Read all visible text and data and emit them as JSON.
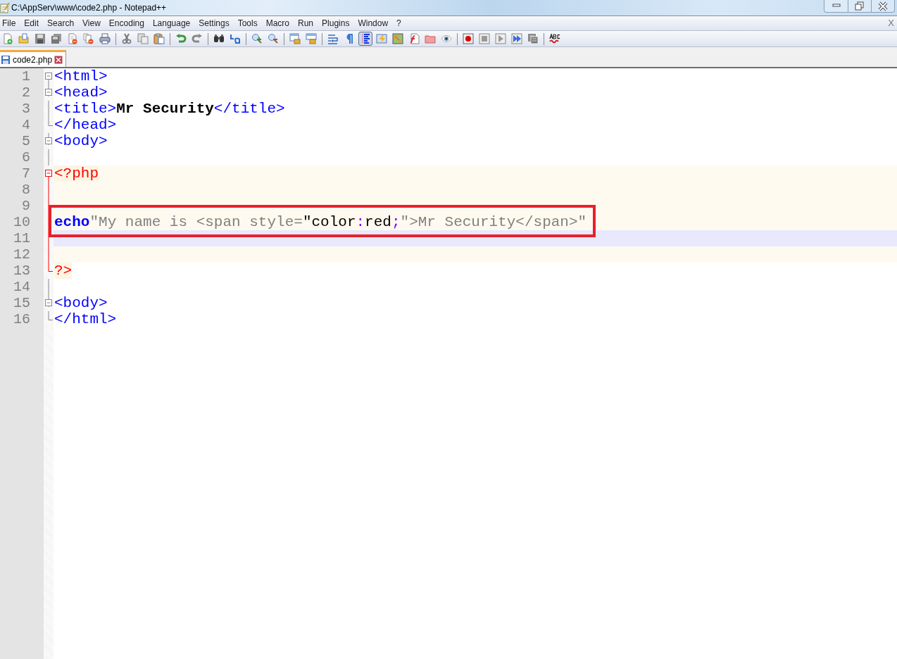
{
  "window": {
    "title": "C:\\AppServ\\www\\code2.php - Notepad++"
  },
  "menu": [
    {
      "label": "File"
    },
    {
      "label": "Edit"
    },
    {
      "label": "Search"
    },
    {
      "label": "View"
    },
    {
      "label": "Encoding"
    },
    {
      "label": "Language"
    },
    {
      "label": "Settings"
    },
    {
      "label": "Tools"
    },
    {
      "label": "Macro"
    },
    {
      "label": "Run"
    },
    {
      "label": "Plugins"
    },
    {
      "label": "Window"
    },
    {
      "label": "?"
    }
  ],
  "menu_close": "X",
  "toolbar": [
    {
      "kind": "new",
      "selected": false
    },
    {
      "kind": "open",
      "selected": false
    },
    {
      "kind": "save",
      "selected": false
    },
    {
      "kind": "save-all",
      "selected": false
    },
    {
      "kind": "close",
      "selected": false
    },
    {
      "kind": "close-all",
      "selected": false
    },
    {
      "kind": "print",
      "selected": false
    },
    {
      "kind": "separator"
    },
    {
      "kind": "cut",
      "selected": false
    },
    {
      "kind": "copy",
      "selected": false
    },
    {
      "kind": "paste",
      "selected": false
    },
    {
      "kind": "separator"
    },
    {
      "kind": "undo",
      "selected": false
    },
    {
      "kind": "redo",
      "selected": false
    },
    {
      "kind": "separator"
    },
    {
      "kind": "find",
      "selected": false
    },
    {
      "kind": "replace",
      "selected": false
    },
    {
      "kind": "separator"
    },
    {
      "kind": "zoom-in",
      "selected": false
    },
    {
      "kind": "zoom-out",
      "selected": false
    },
    {
      "kind": "separator"
    },
    {
      "kind": "sync-v",
      "selected": false
    },
    {
      "kind": "sync-h",
      "selected": false
    },
    {
      "kind": "separator"
    },
    {
      "kind": "wrap",
      "selected": false
    },
    {
      "kind": "pilcrow",
      "selected": false
    },
    {
      "kind": "indent-guide",
      "selected": true
    },
    {
      "kind": "lightning",
      "selected": false
    },
    {
      "kind": "map",
      "selected": false
    },
    {
      "kind": "function-list",
      "selected": false
    },
    {
      "kind": "folder",
      "selected": false
    },
    {
      "kind": "eye",
      "selected": false
    },
    {
      "kind": "separator"
    },
    {
      "kind": "record",
      "selected": false
    },
    {
      "kind": "stop",
      "selected": false
    },
    {
      "kind": "play",
      "selected": false
    },
    {
      "kind": "play-multi",
      "selected": false
    },
    {
      "kind": "save-macro",
      "selected": false
    },
    {
      "kind": "separator"
    },
    {
      "kind": "spellcheck",
      "selected": false
    }
  ],
  "tabs": [
    {
      "label": "code2.php",
      "selected": true
    }
  ],
  "lines": [
    {
      "number": "1",
      "fold_start": true,
      "fold_end": false,
      "php_fold": false,
      "php_block": false,
      "current": false,
      "highlighted": false,
      "tokens": [
        {
          "kind": "tag",
          "text": "<html>"
        }
      ]
    },
    {
      "number": "2",
      "fold_start": true,
      "fold_end": false,
      "php_fold": false,
      "php_block": false,
      "current": false,
      "highlighted": false,
      "tokens": [
        {
          "kind": "tag",
          "text": "<head>"
        }
      ]
    },
    {
      "number": "3",
      "fold_start": false,
      "fold_end": false,
      "php_fold": false,
      "php_block": false,
      "current": false,
      "highlighted": false,
      "tokens": [
        {
          "kind": "tag",
          "text": "<title>"
        },
        {
          "kind": "content",
          "text": "Mr Security"
        },
        {
          "kind": "tag",
          "text": "</title>"
        }
      ]
    },
    {
      "number": "4",
      "fold_start": false,
      "fold_end": true,
      "php_fold": false,
      "php_block": false,
      "current": false,
      "highlighted": false,
      "tokens": [
        {
          "kind": "tag",
          "text": "</head>"
        }
      ]
    },
    {
      "number": "5",
      "fold_start": true,
      "fold_end": false,
      "php_fold": false,
      "php_block": false,
      "current": false,
      "highlighted": false,
      "tokens": [
        {
          "kind": "tag",
          "text": "<body>"
        }
      ]
    },
    {
      "number": "6",
      "fold_start": false,
      "fold_end": false,
      "php_fold": false,
      "php_block": false,
      "current": false,
      "highlighted": false
    },
    {
      "number": "7",
      "fold_start": true,
      "fold_end": false,
      "php_fold": true,
      "php_block": true,
      "current": false,
      "highlighted": false,
      "tokens": [
        {
          "kind": "php-delim",
          "text": "<?php"
        }
      ]
    },
    {
      "number": "8",
      "fold_start": false,
      "fold_end": false,
      "php_fold": true,
      "php_block": true,
      "current": false,
      "highlighted": false
    },
    {
      "number": "9",
      "fold_start": false,
      "fold_end": false,
      "php_fold": true,
      "php_block": true,
      "current": false,
      "highlighted": false
    },
    {
      "number": "10",
      "fold_start": false,
      "fold_end": false,
      "php_fold": true,
      "php_block": true,
      "current": false,
      "highlighted": true,
      "tokens": [
        {
          "kind": "keyword",
          "text": "echo"
        },
        {
          "kind": "string",
          "text": "\"My name is <span style="
        },
        {
          "kind": "css",
          "text": "\"color"
        },
        {
          "kind": "css-op",
          "text": ":"
        },
        {
          "kind": "css",
          "text": "red"
        },
        {
          "kind": "css-op",
          "text": ";"
        },
        {
          "kind": "string",
          "text": "\">Mr Security</span>\""
        }
      ]
    },
    {
      "number": "11",
      "fold_start": false,
      "fold_end": false,
      "php_fold": true,
      "php_block": true,
      "current": true,
      "highlighted": false
    },
    {
      "number": "12",
      "fold_start": false,
      "fold_end": false,
      "php_fold": true,
      "php_block": true,
      "current": false,
      "highlighted": false
    },
    {
      "number": "13",
      "fold_start": false,
      "fold_end": true,
      "php_fold": true,
      "php_block": false,
      "current": false,
      "highlighted": false,
      "tokens": [
        {
          "kind": "php-delim",
          "text": "?>"
        }
      ]
    },
    {
      "number": "14",
      "fold_start": false,
      "fold_end": false,
      "php_fold": false,
      "php_block": false,
      "current": false,
      "highlighted": false
    },
    {
      "number": "15",
      "fold_start": true,
      "fold_end": false,
      "php_fold": false,
      "php_block": false,
      "current": false,
      "highlighted": false,
      "tokens": [
        {
          "kind": "tag",
          "text": "<body>"
        }
      ]
    },
    {
      "number": "16",
      "fold_start": false,
      "fold_end": true,
      "php_fold": false,
      "php_block": false,
      "current": false,
      "highlighted": false,
      "tokens": [
        {
          "kind": "tag",
          "text": "</html>"
        }
      ]
    }
  ]
}
